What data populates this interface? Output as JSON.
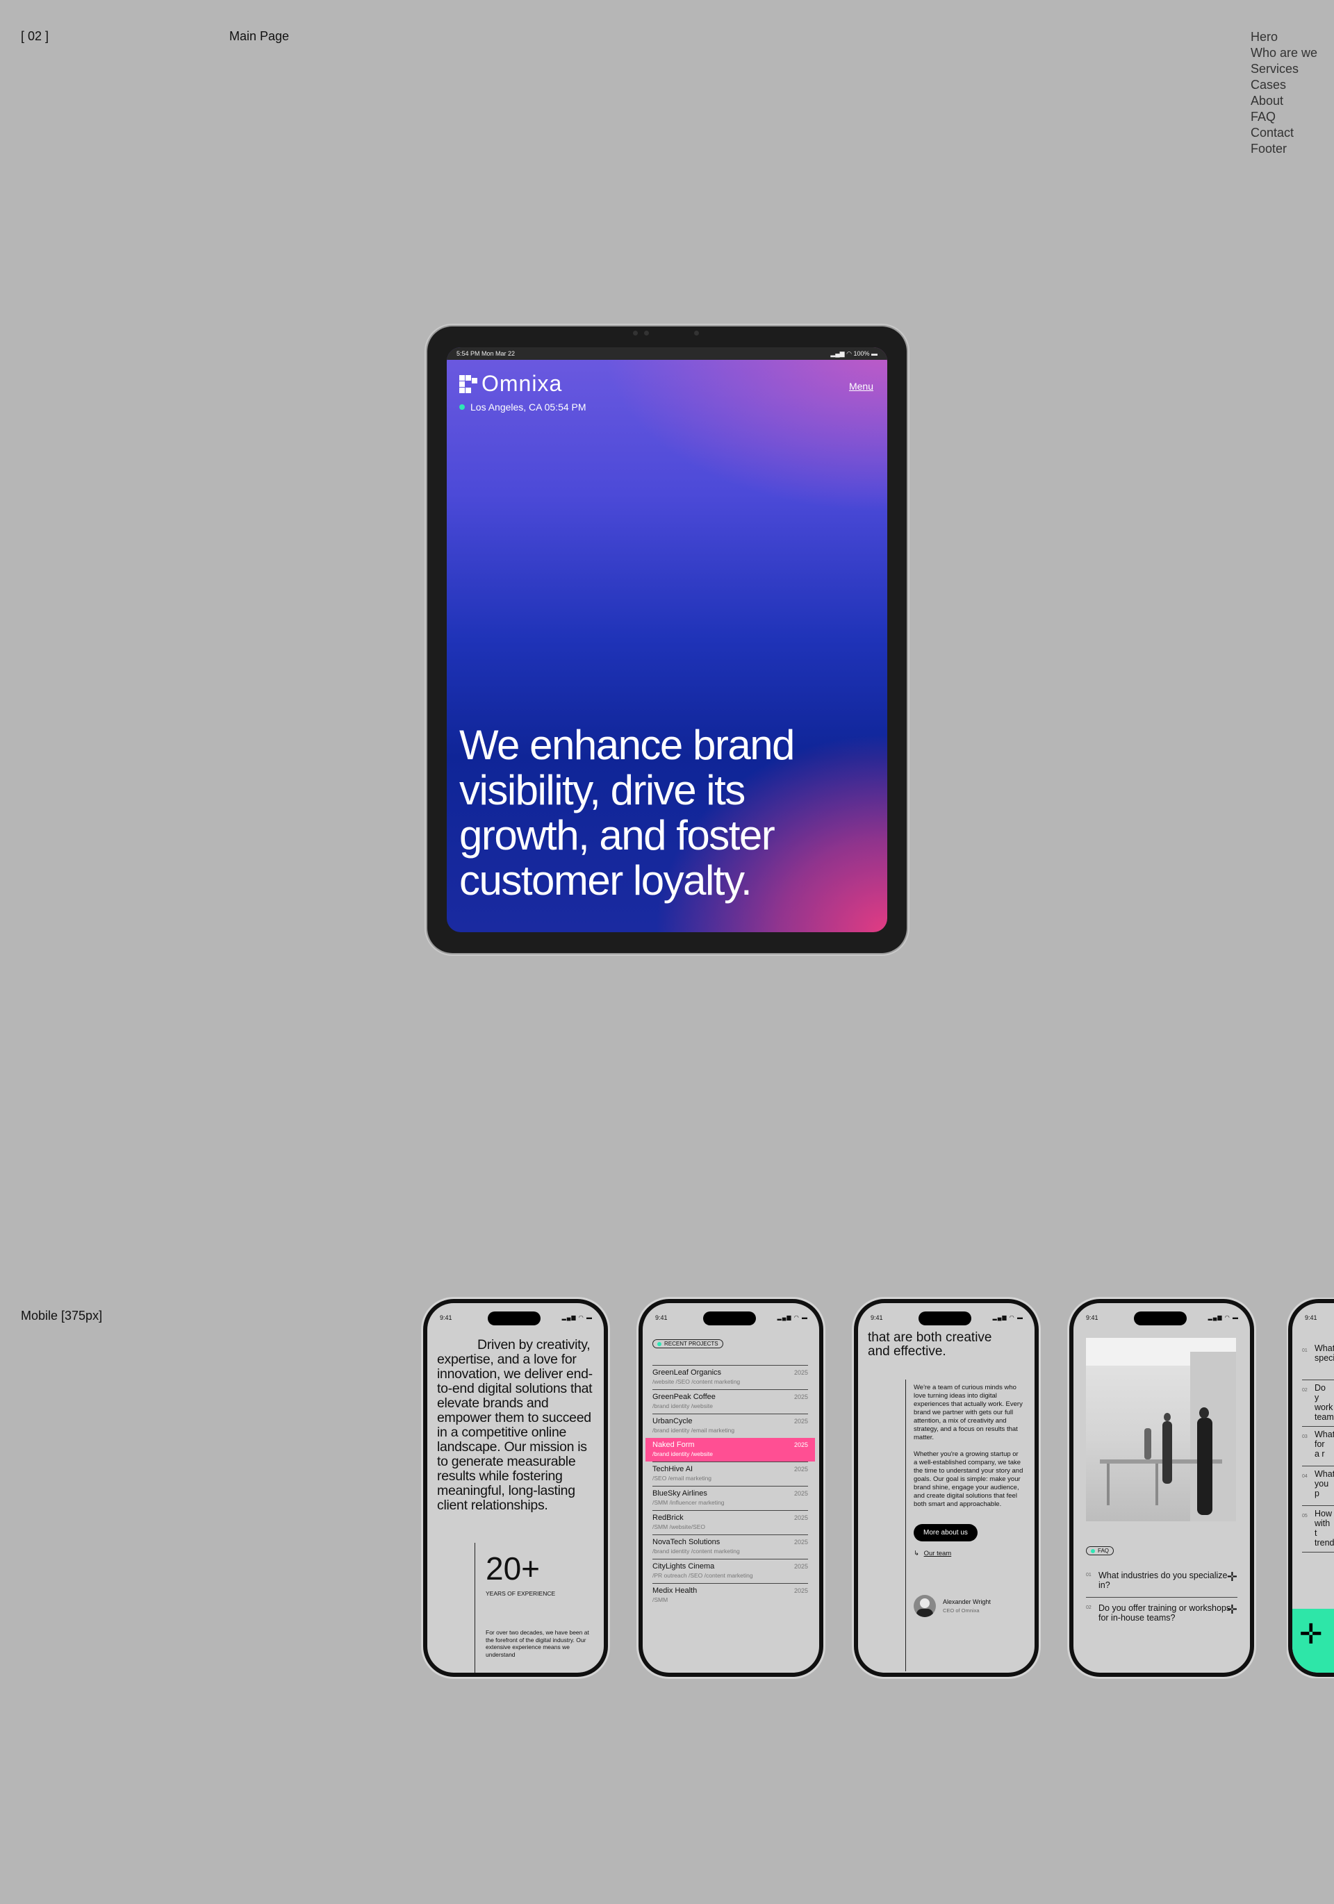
{
  "header": {
    "number": "[ 02 ]",
    "title": "Main Page"
  },
  "right_nav": [
    "Hero",
    "Who are we",
    "Services",
    "Cases",
    "About",
    "FAQ",
    "Contact",
    "Footer"
  ],
  "mobile_label": "Mobile [375px]",
  "tablet": {
    "status_left": "5:54 PM   Mon Mar 22",
    "status_right": "100%",
    "logo": "Omnixa",
    "menu": "Menu",
    "location": "Los Angeles, CA 05:54 PM",
    "headline": "We enhance brand visibility, drive its growth, and foster customer loyalty.",
    "colors": {
      "accent_dot": "#2ee6b5",
      "gradient_top": "#6d5ae0",
      "gradient_mid": "#0f2597",
      "gradient_corner": "#e23c83"
    }
  },
  "phones": {
    "time": "9:41",
    "p1": {
      "paragraph": "Driven by creativity, expertise, and a love for innovation, we deliver end-to-end digital solutions that elevate brands and empower them to succeed in a competitive online landscape. Our mission is to generate measurable results while fostering meaningful, long-lasting client relationships.",
      "stat": "20+",
      "stat_label": "YEARS OF EXPERIENCE",
      "small": "For over two decades, we have been at the forefront of the digital industry. Our extensive experience means we understand"
    },
    "p2": {
      "badge": "RECENT PROJECTS",
      "projects": [
        {
          "name": "GreenLeaf Organics",
          "tags": "/website /SEO /content marketing",
          "year": "2025"
        },
        {
          "name": "GreenPeak Coffee",
          "tags": "/brand identity /website",
          "year": "2025"
        },
        {
          "name": "UrbanCycle",
          "tags": "/brand identity /email marketing",
          "year": "2025"
        },
        {
          "name": "Naked Form",
          "tags": "/brand identity /website",
          "year": "2025"
        },
        {
          "name": "TechHive AI",
          "tags": "/SEO /email marketing",
          "year": "2025"
        },
        {
          "name": "BlueSky Airlines",
          "tags": "/SMM /influencer marketing",
          "year": "2025"
        },
        {
          "name": "RedBrick",
          "tags": "/SMM /website/SEO",
          "year": "2025"
        },
        {
          "name": "NovaTech Solutions",
          "tags": "/brand identity /content marketing",
          "year": "2025"
        },
        {
          "name": "CityLights Cinema",
          "tags": "/PR outreach /SEO /content marketing",
          "year": "2025"
        },
        {
          "name": "Medix Health",
          "tags": "/SMM",
          "year": "2025"
        }
      ],
      "highlight_color": "#ff4f93"
    },
    "p3": {
      "big": "that are both creative and effective.",
      "para1": "We're a team of curious minds who love turning ideas into digital experiences that actually work. Every brand we partner with gets our full attention, a mix of creativity and strategy, and a focus on results that matter.",
      "para2": "Whether you're a growing startup or a well-established company, we take the time to understand your story and goals. Our goal is simple: make your brand shine, engage your audience, and create digital solutions that feel both smart and approachable.",
      "button": "More about us",
      "link": "Our team",
      "person_name": "Alexander Wright",
      "person_role": "CEO of Omnixa"
    },
    "p4": {
      "badge": "FAQ",
      "q1_num": "01",
      "q1": "What industries do you specialize in?",
      "q2_num": "02",
      "q2": "Do you offer training or workshops for in-house teams?"
    },
    "p5": {
      "items": [
        {
          "num": "01",
          "text": "What speci"
        },
        {
          "num": "02",
          "text": "Do y work team"
        },
        {
          "num": "03",
          "text": "What for a r"
        },
        {
          "num": "04",
          "text": "What you p"
        },
        {
          "num": "05",
          "text": "How with t trend"
        }
      ],
      "accent_color": "#2ee6a8"
    }
  }
}
